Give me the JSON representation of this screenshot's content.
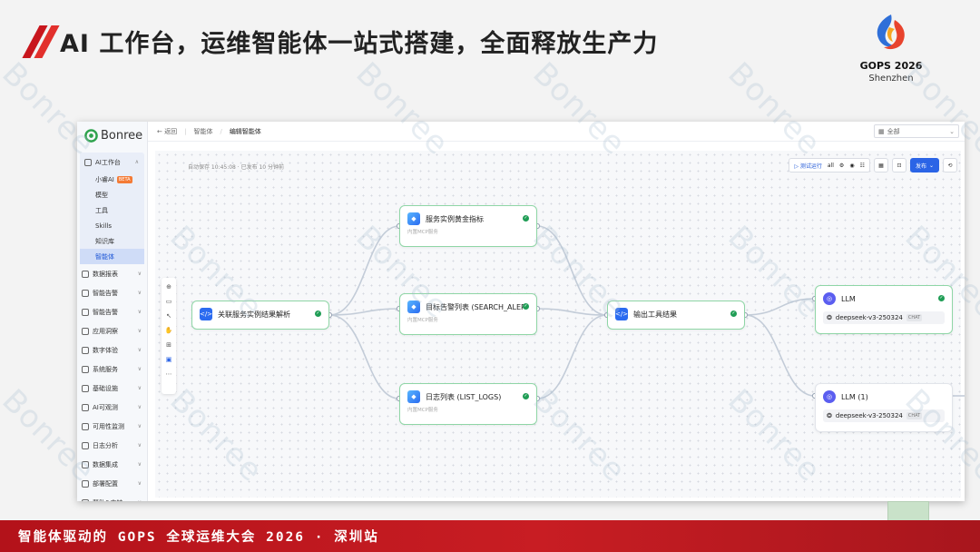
{
  "slide": {
    "title": "AI 工作台，运维智能体一站式搭建，全面释放生产力",
    "logo_line1": "GOPS 2026",
    "logo_line2": "Shenzhen",
    "footer": "智能体驱动的 GOPS 全球运维大会 2026 · 深圳站",
    "watermark": "Bonree"
  },
  "app": {
    "logo_text": "Bonree",
    "breadcrumb": {
      "back": "返回",
      "crumb1": "智能体",
      "current": "编辑智能体"
    },
    "filter": {
      "value": "全部"
    },
    "sidebar": {
      "group_label": "AI工作台",
      "sub_items": [
        {
          "label": "小睿AI",
          "badge": "BETA"
        },
        {
          "label": "模型"
        },
        {
          "label": "工具"
        },
        {
          "label": "Skills"
        },
        {
          "label": "知识库"
        },
        {
          "label": "智能体"
        }
      ],
      "items": [
        "数据报表",
        "智能告警",
        "智能告警",
        "应用洞察",
        "数字体验",
        "系统服务",
        "基础设施",
        "AI可观测",
        "可用性监测",
        "日志分析",
        "数据集成",
        "部署配置",
        "帮助&支持"
      ]
    },
    "canvas": {
      "autosave": "自动保存 10:45:08 · 已发布 10 分钟前",
      "test_run": "测试运行",
      "test_all": "all",
      "publish": "发布"
    },
    "nodes": {
      "n_parse": {
        "title": "关联服务实例结果解析"
      },
      "n_gold": {
        "title": "服务实例黄金指标",
        "sub": "内置MCP服务"
      },
      "n_alert": {
        "title": "目标告警列表 (SEARCH_ALERTS)",
        "sub": "内置MCP服务"
      },
      "n_logs": {
        "title": "日志列表 (LIST_LOGS)",
        "sub": "内置MCP服务"
      },
      "n_output": {
        "title": "输出工具结果"
      },
      "n_llm": {
        "title": "LLM",
        "model": "deepseek-v3-250324",
        "tag": "CHAT"
      },
      "n_llm1": {
        "title": "LLM (1)",
        "model": "deepseek-v3-250324",
        "tag": "CHAT"
      }
    }
  },
  "colors": {
    "accent_red": "#c8161d",
    "primary_blue": "#2b64e6",
    "node_border": "#8fd6a6",
    "success": "#1f9d55"
  }
}
